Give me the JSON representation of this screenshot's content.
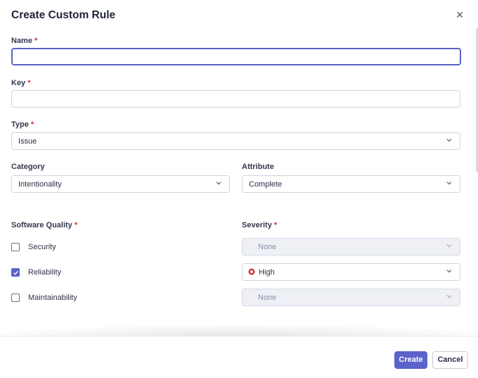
{
  "dialog": {
    "title": "Create Custom Rule",
    "close_icon": "close-icon"
  },
  "fields": {
    "name": {
      "label": "Name",
      "value": ""
    },
    "key": {
      "label": "Key",
      "value": ""
    },
    "type": {
      "label": "Type",
      "value": "Issue"
    },
    "category": {
      "label": "Category",
      "value": "Intentionality"
    },
    "attribute": {
      "label": "Attribute",
      "value": "Complete"
    }
  },
  "required_marker": "*",
  "software_quality": {
    "label": "Software Quality",
    "items": [
      {
        "label": "Security",
        "checked": false,
        "severity": "None",
        "severity_enabled": false
      },
      {
        "label": "Reliability",
        "checked": true,
        "severity": "High",
        "severity_enabled": true
      },
      {
        "label": "Maintainability",
        "checked": false,
        "severity": "None",
        "severity_enabled": false
      }
    ]
  },
  "severity": {
    "label": "Severity"
  },
  "footer": {
    "create_label": "Create",
    "cancel_label": "Cancel"
  },
  "colors": {
    "accent": "#5b62c9",
    "required": "#d02f3a",
    "high_severity": "#d02f3a"
  }
}
